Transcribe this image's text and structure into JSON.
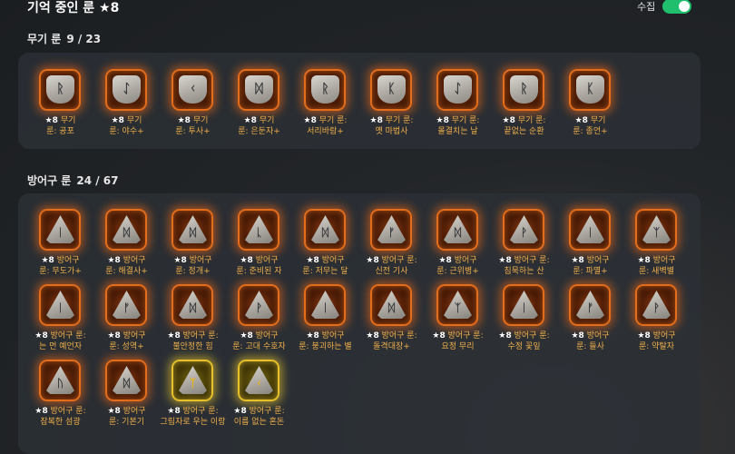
{
  "header": {
    "title": "기억 중인 룬 ★8",
    "toggle_label": "수집",
    "toggle_on": true
  },
  "weapon": {
    "heading": "무기 룬",
    "count": "9 / 23",
    "items": [
      {
        "glyph": "ᚱ",
        "shape": "shield",
        "tier": "orange",
        "line1": "무기",
        "line2": "룬: 공포"
      },
      {
        "glyph": "ᛇ",
        "shape": "shield",
        "tier": "orange",
        "line1": "무기",
        "line2": "룬: 야수+"
      },
      {
        "glyph": "ᚲ",
        "shape": "shield",
        "tier": "orange",
        "line1": "무기",
        "line2": "룬: 투사+"
      },
      {
        "glyph": "ᛞ",
        "shape": "shield",
        "tier": "orange",
        "line1": "무기",
        "line2": "룬: 은둔자+"
      },
      {
        "glyph": "ᚱ",
        "shape": "shield",
        "tier": "orange",
        "line1": "무기 룬:",
        "line2": "서리바람+"
      },
      {
        "glyph": "ᛕ",
        "shape": "shield",
        "tier": "orange",
        "line1": "무기 룬:",
        "line2": "옛 마법사"
      },
      {
        "glyph": "ᛇ",
        "shape": "shield",
        "tier": "orange",
        "line1": "무기 룬:",
        "line2": "몰결치는 날"
      },
      {
        "glyph": "ᚱ",
        "shape": "shield",
        "tier": "orange",
        "line1": "무기 룬:",
        "line2": "끝없는 순환"
      },
      {
        "glyph": "ᛕ",
        "shape": "shield",
        "tier": "orange",
        "line1": "무기",
        "line2": "룬: 종언+"
      }
    ]
  },
  "armor": {
    "heading": "방어구 룬",
    "count": "24 / 67",
    "items": [
      {
        "glyph": "ᛁ",
        "shape": "tri",
        "tier": "orange",
        "line1": "방어구",
        "line2": "룬: 무도가+"
      },
      {
        "glyph": "ᛞ",
        "shape": "tri",
        "tier": "orange",
        "line1": "방어구",
        "line2": "룬: 해결사+"
      },
      {
        "glyph": "ᛞ",
        "shape": "tri",
        "tier": "orange",
        "line1": "방어구",
        "line2": "룬: 정개+"
      },
      {
        "glyph": "ᚳ",
        "shape": "tri",
        "tier": "orange",
        "line1": "방어구",
        "line2": "룬: 준비된 자"
      },
      {
        "glyph": "ᛞ",
        "shape": "tri",
        "tier": "orange",
        "line1": "방어구",
        "line2": "룬: 저무는 달"
      },
      {
        "glyph": "ᚠ",
        "shape": "tri",
        "tier": "orange",
        "line1": "방어구 룬:",
        "line2": "신전 기사"
      },
      {
        "glyph": "ᛞ",
        "shape": "tri",
        "tier": "orange",
        "line1": "방어구",
        "line2": "룬: 근위병+"
      },
      {
        "glyph": "ᚹ",
        "shape": "tri",
        "tier": "orange",
        "line1": "방어구 룬:",
        "line2": "침묵하는 산"
      },
      {
        "glyph": "ᛁ",
        "shape": "tri",
        "tier": "orange",
        "line1": "방어구",
        "line2": "룬: 파멸+"
      },
      {
        "glyph": "ᛉ",
        "shape": "tri",
        "tier": "orange",
        "line1": "방어구",
        "line2": "룬: 새벽별"
      },
      {
        "glyph": "ᛁ",
        "shape": "tri",
        "tier": "orange",
        "line1": "방어구 룬:",
        "line2": "는 먼 예언자"
      },
      {
        "glyph": "ᚠ",
        "shape": "tri",
        "tier": "orange",
        "line1": "방어구",
        "line2": "룬: 성역+"
      },
      {
        "glyph": "ᛞ",
        "shape": "tri",
        "tier": "orange",
        "line1": "방어구 룬:",
        "line2": "불안정한 힘"
      },
      {
        "glyph": "ᚹ",
        "shape": "tri",
        "tier": "orange",
        "line1": "방어구",
        "line2": "룬: 고대 수호자"
      },
      {
        "glyph": "ᛁ",
        "shape": "tri",
        "tier": "orange",
        "line1": "방어구",
        "line2": "룬: 붕괴하는 별"
      },
      {
        "glyph": "ᛞ",
        "shape": "tri",
        "tier": "orange",
        "line1": "방어구 룬:",
        "line2": "돌격대장+"
      },
      {
        "glyph": "ᛉ",
        "shape": "tri",
        "tier": "orange",
        "line1": "방어구 룬:",
        "line2": "요정 무리"
      },
      {
        "glyph": "ᛁ",
        "shape": "tri",
        "tier": "orange",
        "line1": "방어구 룬:",
        "line2": "수정 꽃잎"
      },
      {
        "glyph": "ᚠ",
        "shape": "tri",
        "tier": "orange",
        "line1": "방어구",
        "line2": "룬: 들사"
      },
      {
        "glyph": "ᚹ",
        "shape": "tri",
        "tier": "orange",
        "line1": "방어구",
        "line2": "룬: 약탈자"
      },
      {
        "glyph": "ᚢ",
        "shape": "tri",
        "tier": "orange",
        "line1": "방어구 룬:",
        "line2": "잠복한 섬광"
      },
      {
        "glyph": "ᛞ",
        "shape": "tri",
        "tier": "orange",
        "line1": "방어구",
        "line2": "룬: 기본기"
      },
      {
        "glyph": "ᛉ",
        "shape": "tri",
        "tier": "gold",
        "line1": "방어구 룬:",
        "line2": "그림자로 우는 이랑"
      },
      {
        "glyph": "ᚲ",
        "shape": "tri",
        "tier": "gold",
        "line1": "방어구 룬:",
        "line2": "이름 없는 혼돈"
      }
    ]
  },
  "star_label": "★8",
  "colors": {
    "accent_orange": "#e46d1b",
    "accent_gold": "#e8c12a",
    "toggle_green": "#1fbf6e",
    "label_text": "#f1b04a"
  }
}
